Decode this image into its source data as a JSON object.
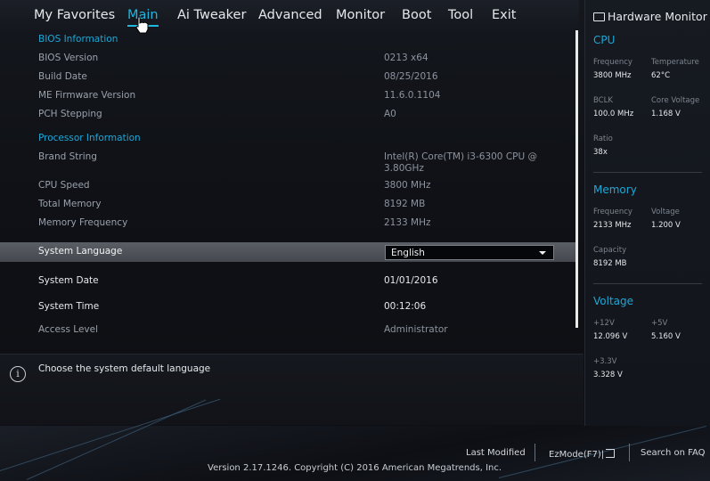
{
  "tabs": [
    {
      "label": "My Favorites"
    },
    {
      "label": "Main"
    },
    {
      "label": "Ai Tweaker"
    },
    {
      "label": "Advanced"
    },
    {
      "label": "Monitor"
    },
    {
      "label": "Boot"
    },
    {
      "label": "Tool"
    },
    {
      "label": "Exit"
    }
  ],
  "active_tab": "Main",
  "main": {
    "bios_info_heading": "BIOS Information",
    "bios_version_label": "BIOS Version",
    "bios_version_value": "0213  x64",
    "build_date_label": "Build Date",
    "build_date_value": "08/25/2016",
    "me_fw_label": "ME Firmware Version",
    "me_fw_value": "11.6.0.1104",
    "pch_label": "PCH Stepping",
    "pch_value": "A0",
    "proc_info_heading": "Processor Information",
    "brand_label": "Brand String",
    "brand_value_line1": "Intel(R) Core(TM) i3-6300 CPU @",
    "brand_value_line2": "3.80GHz",
    "cpu_speed_label": "CPU Speed",
    "cpu_speed_value": "3800 MHz",
    "total_mem_label": "Total Memory",
    "total_mem_value": "8192 MB",
    "mem_freq_label": "Memory Frequency",
    "mem_freq_value": "2133 MHz",
    "sys_lang_label": "System Language",
    "sys_lang_value": "English",
    "sys_date_label": "System Date",
    "sys_date_value": "01/01/2016",
    "sys_time_label": "System Time",
    "sys_time_value": "00:12:06",
    "access_label": "Access Level",
    "access_value": "Administrator"
  },
  "help": {
    "text": "Choose the system default language"
  },
  "hw_monitor": {
    "title": "Hardware Monitor",
    "cpu": {
      "heading": "CPU",
      "freq_label": "Frequency",
      "freq_value": "3800 MHz",
      "temp_label": "Temperature",
      "temp_value": "62°C",
      "bclk_label": "BCLK",
      "bclk_value": "100.0 MHz",
      "corev_label": "Core Voltage",
      "corev_value": "1.168 V",
      "ratio_label": "Ratio",
      "ratio_value": "38x"
    },
    "memory": {
      "heading": "Memory",
      "freq_label": "Frequency",
      "freq_value": "2133 MHz",
      "volt_label": "Voltage",
      "volt_value": "1.200 V",
      "cap_label": "Capacity",
      "cap_value": "8192 MB"
    },
    "voltage": {
      "heading": "Voltage",
      "v12_label": "+12V",
      "v12_value": "12.096 V",
      "v5_label": "+5V",
      "v5_value": "5.160 V",
      "v33_label": "+3.3V",
      "v33_value": "3.328 V"
    }
  },
  "footer": {
    "last_modified": "Last Modified",
    "ezmode": "EzMode(F7)|",
    "search_faq": "Search on FAQ",
    "version": "Version 2.17.1246. Copyright (C) 2016 American Megatrends, Inc."
  },
  "colors": {
    "accent": "#1fb6e0",
    "section": "#1ea7d6",
    "selected_row": "#4f5359"
  }
}
